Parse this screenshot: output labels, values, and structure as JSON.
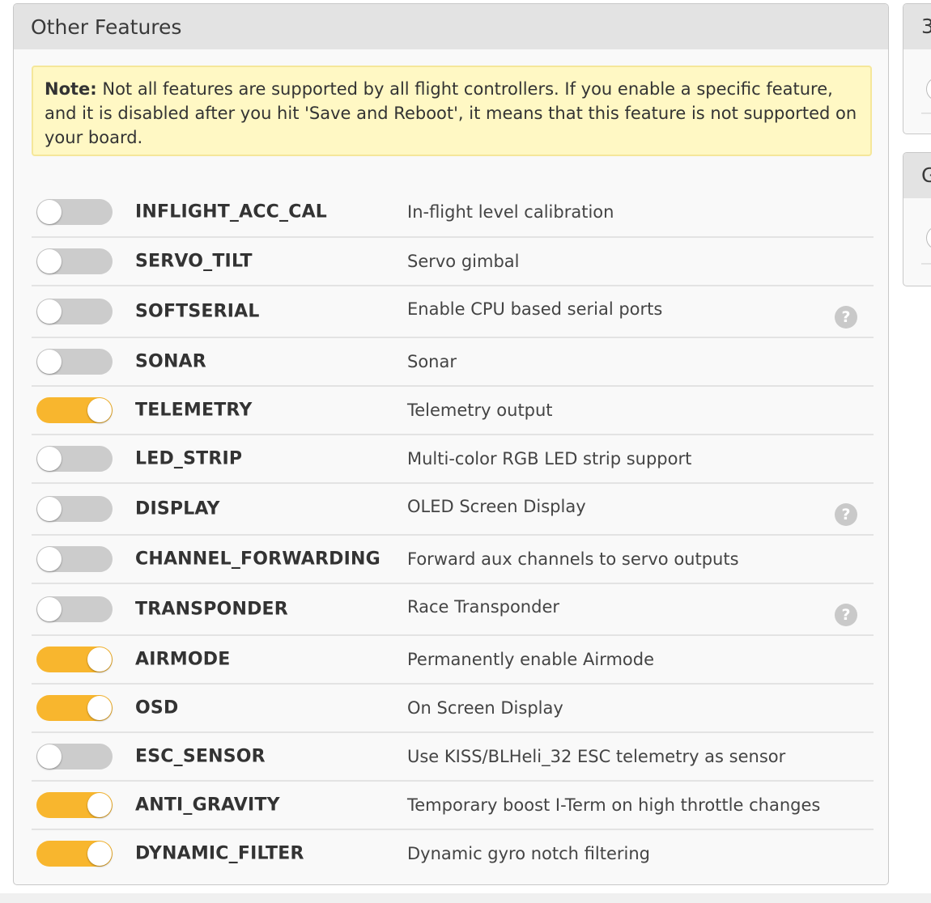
{
  "panel": {
    "title": "Other Features",
    "note_label": "Note:",
    "note_text": " Not all features are supported by all flight controllers. If you enable a specific feature, and it is disabled after you hit 'Save and Reboot', it means that this feature is not supported on your board."
  },
  "features": [
    {
      "name": "INFLIGHT_ACC_CAL",
      "description": "In-flight level calibration",
      "enabled": false,
      "help": false
    },
    {
      "name": "SERVO_TILT",
      "description": "Servo gimbal",
      "enabled": false,
      "help": false
    },
    {
      "name": "SOFTSERIAL",
      "description": "Enable CPU based serial ports",
      "enabled": false,
      "help": true
    },
    {
      "name": "SONAR",
      "description": "Sonar",
      "enabled": false,
      "help": false
    },
    {
      "name": "TELEMETRY",
      "description": "Telemetry output",
      "enabled": true,
      "help": false
    },
    {
      "name": "LED_STRIP",
      "description": "Multi-color RGB LED strip support",
      "enabled": false,
      "help": false
    },
    {
      "name": "DISPLAY",
      "description": "OLED Screen Display",
      "enabled": false,
      "help": true
    },
    {
      "name": "CHANNEL_FORWARDING",
      "description": "Forward aux channels to servo outputs",
      "enabled": false,
      "help": false
    },
    {
      "name": "TRANSPONDER",
      "description": "Race Transponder",
      "enabled": false,
      "help": true
    },
    {
      "name": "AIRMODE",
      "description": "Permanently enable Airmode",
      "enabled": true,
      "help": false
    },
    {
      "name": "OSD",
      "description": "On Screen Display",
      "enabled": true,
      "help": false
    },
    {
      "name": "ESC_SENSOR",
      "description": "Use KISS/BLHeli_32 ESC telemetry as sensor",
      "enabled": false,
      "help": false
    },
    {
      "name": "ANTI_GRAVITY",
      "description": "Temporary boost I-Term on high throttle changes",
      "enabled": true,
      "help": false
    },
    {
      "name": "DYNAMIC_FILTER",
      "description": "Dynamic gyro notch filtering",
      "enabled": true,
      "help": false
    }
  ],
  "help_glyph": "?",
  "side_panels": [
    {
      "title": "3"
    },
    {
      "title": "G"
    }
  ],
  "colors": {
    "switch_on": "#f8b62e",
    "switch_off": "#cccccc",
    "note_background": "#fff8c4",
    "note_border": "#f5e79a"
  }
}
